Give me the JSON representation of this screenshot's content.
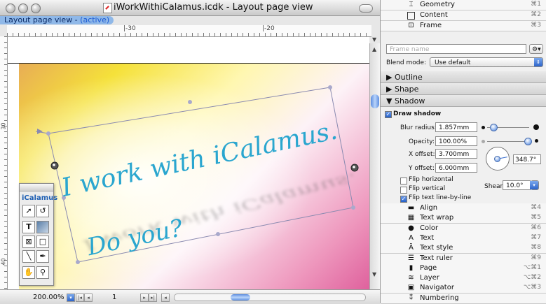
{
  "window": {
    "title": "iWorkWithiCalamus.icdk - Layout page view",
    "tab_label": "Layout page view - ",
    "tab_state": "(active)"
  },
  "ruler": {
    "h_labels": [
      "|-30",
      "|-20"
    ],
    "v_labels": [
      "30",
      "40"
    ]
  },
  "canvas": {
    "text_line1": "I work with iCalamus.",
    "text_line2": "Do you?",
    "text_color": "#2aa6cf"
  },
  "toolbox": {
    "name": "iCalamus",
    "tools": [
      "arrow-tool",
      "rotate-tool",
      "text-tool",
      "image-tool",
      "picture-frame-tool",
      "rectangle-tool",
      "line-tool",
      "bezier-tool",
      "hand-tool",
      "zoom-tool"
    ]
  },
  "status": {
    "zoom": "200.00%",
    "page": "1"
  },
  "panel": {
    "top_items": [
      {
        "label": "Geometry",
        "shortcut": "⌘1",
        "icon": "geometry-icon"
      },
      {
        "label": "Content",
        "shortcut": "⌘2",
        "icon": "content-icon"
      },
      {
        "label": "Frame",
        "shortcut": "⌘3",
        "icon": "frame-icon"
      }
    ],
    "frame_name_placeholder": "Frame name",
    "blend_label": "Blend mode:",
    "blend_value": "Use default",
    "sections": [
      "Outline",
      "Shape",
      "Shadow"
    ],
    "shadow": {
      "draw_label": "Draw shadow",
      "blur_label": "Blur radius:",
      "blur_value": "1.857mm",
      "opacity_label": "Opacity:",
      "opacity_value": "100.00%",
      "xoff_label": "X offset:",
      "xoff_value": "3.700mm",
      "yoff_label": "Y offset:",
      "yoff_value": "6.000mm",
      "angle_value": "348.7°",
      "flip_h": "Flip horizontal",
      "flip_v": "Flip vertical",
      "flip_text": "Flip text line-by-line",
      "shear_label": "Shear:",
      "shear_value": "10.0°"
    },
    "bottom_items": [
      {
        "label": "Align",
        "shortcut": "⌘4",
        "icon": "align-icon"
      },
      {
        "label": "Text wrap",
        "shortcut": "⌘5",
        "icon": "text-wrap-icon"
      },
      {
        "label": "Color",
        "shortcut": "⌘6",
        "icon": "color-icon"
      },
      {
        "label": "Text",
        "shortcut": "⌘7",
        "icon": "text-icon"
      },
      {
        "label": "Text style",
        "shortcut": "⌘8",
        "icon": "text-style-icon"
      },
      {
        "label": "Text ruler",
        "shortcut": "⌘9",
        "icon": "text-ruler-icon"
      },
      {
        "label": "Page",
        "shortcut": "⌥⌘1",
        "icon": "page-icon"
      },
      {
        "label": "Layer",
        "shortcut": "⌥⌘2",
        "icon": "layer-icon"
      },
      {
        "label": "Navigator",
        "shortcut": "⌥⌘3",
        "icon": "navigator-icon"
      },
      {
        "label": "Numbering",
        "shortcut": "",
        "icon": "numbering-icon"
      }
    ]
  }
}
